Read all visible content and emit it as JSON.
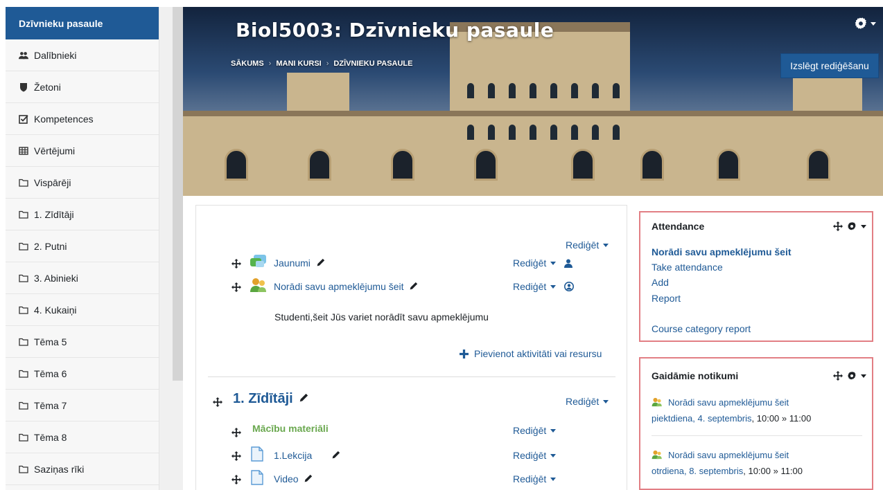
{
  "sidebar": {
    "header": "Dzīvnieku pasaule",
    "items": [
      {
        "label": "Dalībnieki",
        "icon": "users-icon"
      },
      {
        "label": "Žetoni",
        "icon": "shield-icon"
      },
      {
        "label": "Kompetences",
        "icon": "checkbox-icon"
      },
      {
        "label": "Vērtējumi",
        "icon": "table-icon"
      },
      {
        "label": "Vispārēji",
        "icon": "folder-icon"
      },
      {
        "label": "1. Zīdītāji",
        "icon": "folder-icon"
      },
      {
        "label": "2. Putni",
        "icon": "folder-icon"
      },
      {
        "label": "3. Abinieki",
        "icon": "folder-icon"
      },
      {
        "label": "4. Kukaiņi",
        "icon": "folder-icon"
      },
      {
        "label": "Tēma 5",
        "icon": "folder-icon"
      },
      {
        "label": "Tēma 6",
        "icon": "folder-icon"
      },
      {
        "label": "Tēma 7",
        "icon": "folder-icon"
      },
      {
        "label": "Tēma 8",
        "icon": "folder-icon"
      },
      {
        "label": "Saziņas rīki",
        "icon": "folder-icon"
      }
    ]
  },
  "header": {
    "title": "Biol5003: Dzīvnieku pasaule",
    "breadcrumbs": [
      "SĀKUMS",
      "MANI KURSI",
      "DZĪVNIEKU PASAULE"
    ],
    "edit_button": "Izslēgt rediģēšanu"
  },
  "main": {
    "edit_label": "Rediģēt",
    "general_activities": [
      {
        "label": "Jaunumi",
        "icon": "forum-icon"
      },
      {
        "label": "Norādi savu apmeklējumu šeit",
        "icon": "attendance-icon"
      }
    ],
    "description": "Studenti,šeit Jūs variet norādīt savu apmeklējumu",
    "add_activity": "Pievienot aktivitāti vai resursu",
    "section1": {
      "title": "1. Zīdītāji",
      "label_item": "Mācību materiāli",
      "files": [
        "1.Lekcija",
        "Video"
      ]
    }
  },
  "blocks": {
    "attendance": {
      "title": "Attendance",
      "main_link": "Norādi savu apmeklējumu šeit",
      "links": [
        "Take attendance",
        "Add",
        "Report"
      ],
      "category_report": "Course category report"
    },
    "upcoming": {
      "title": "Gaidāmie notikumi",
      "events": [
        {
          "name": "Norādi savu apmeklējumu šeit",
          "day": "piektdiena, 4. septembris",
          "time": ", 10:00 » 11:00"
        },
        {
          "name": "Norādi savu apmeklējumu šeit",
          "day": "otrdiena, 8. septembris",
          "time": ", 10:00 » 11:00"
        }
      ]
    }
  },
  "colors": {
    "primary": "#1f5a96",
    "block_border": "#e27e84",
    "label_green": "#6aa84f"
  }
}
